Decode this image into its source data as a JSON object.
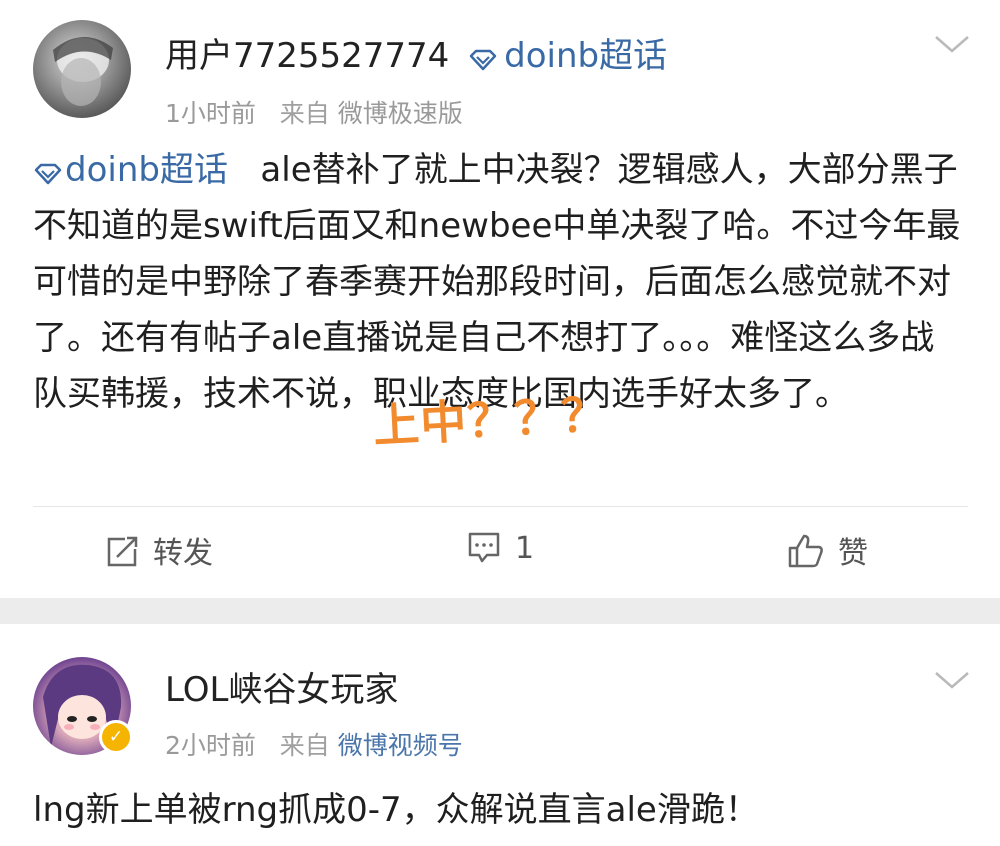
{
  "posts": [
    {
      "username": "用户7725527774",
      "topic": "doinb超话",
      "time": "1小时前",
      "source_prefix": "来自",
      "client": "微博极速版",
      "content_topic": "doinb超话",
      "content_text": "ale替补了就上中决裂？逻辑感人，大部分黑子不知道的是swift后面又和newbee中单决裂了哈。不过今年最可惜的是中野除了春季赛开始那段时间，后面怎么感觉就不对了。还有有帖子ale直播说是自己不想打了。。。难怪这么多战队买韩援，技术不说，职业态度比国内选手好太多了。",
      "overlay": "上中？？？",
      "actions": {
        "repost": "转发",
        "comment": "1",
        "like": "赞"
      }
    },
    {
      "username": "LOL峡谷女玩家",
      "time": "2小时前",
      "source_prefix": "来自",
      "client": "微博视频号",
      "content_text": "lng新上单被rng抓成0-7，众解说直言ale滑跪！"
    }
  ],
  "icons": [
    "chevron-down-icon",
    "super-topic-diamond-icon",
    "repost-icon",
    "comment-icon",
    "like-icon",
    "verified-badge-icon"
  ],
  "colors": {
    "topic_link": "#3a6aa5",
    "overlay_text": "#f28a2e",
    "verified_badge": "#f5b400",
    "separator": "#ececec"
  }
}
